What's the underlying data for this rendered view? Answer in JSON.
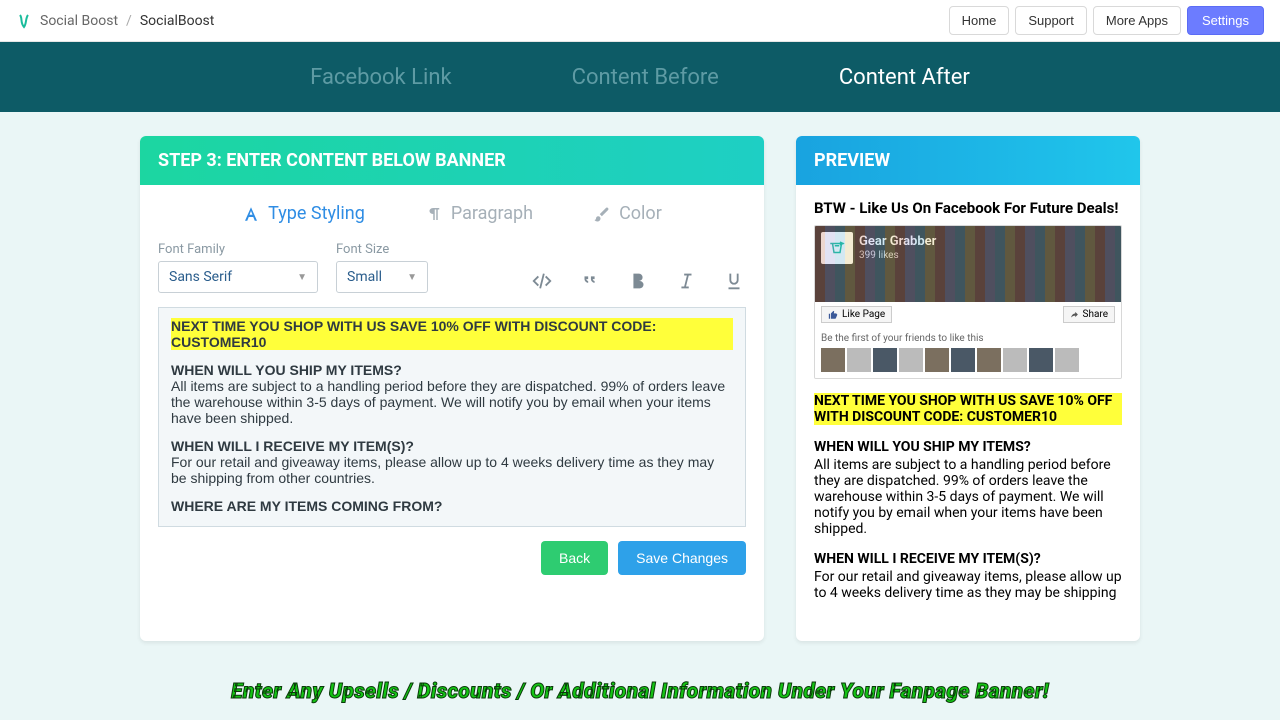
{
  "breadcrumb": {
    "app": "Social Boost",
    "page": "SocialBoost"
  },
  "topnav": {
    "home": "Home",
    "support": "Support",
    "more": "More Apps",
    "settings": "Settings"
  },
  "tabs": {
    "facebook": "Facebook Link",
    "before": "Content Before",
    "after": "Content After"
  },
  "editor": {
    "header": "STEP 3: ENTER CONTENT BELOW BANNER",
    "subtabs": {
      "type": "Type Styling",
      "paragraph": "Paragraph",
      "color": "Color"
    },
    "fields": {
      "font_family_label": "Font Family",
      "font_family_value": "Sans Serif",
      "font_size_label": "Font Size",
      "font_size_value": "Small"
    },
    "content": {
      "promo": "NEXT TIME YOU SHOP WITH US SAVE 10% OFF WITH DISCOUNT CODE: CUSTOMER10",
      "q1": "WHEN WILL YOU SHIP MY ITEMS?",
      "a1": "All items are subject to a handling period before they are dispatched. 99% of orders leave the warehouse within 3-5 days of payment. We will notify you by email when your items have been shipped.",
      "q2": "WHEN WILL I RECEIVE MY ITEM(S)?",
      "a2": "For our retail and giveaway items, please allow up to 4 weeks delivery time as they may be shipping from other countries.",
      "q3": "WHERE ARE MY ITEMS COMING FROM?"
    },
    "actions": {
      "back": "Back",
      "save": "Save Changes"
    }
  },
  "preview": {
    "header": "PREVIEW",
    "title": "BTW - Like Us On Facebook For Future Deals!",
    "fb": {
      "page_name": "Gear Grabber",
      "likes": "399 likes",
      "like_label": "Like Page",
      "share_label": "Share",
      "friends_text": "Be the first of your friends to like this"
    },
    "content": {
      "promo": "NEXT TIME YOU SHOP WITH US SAVE 10% OFF WITH DISCOUNT CODE: CUSTOMER10",
      "q1": "WHEN WILL YOU SHIP MY ITEMS?",
      "a1": "All items are subject to a handling period before they are dispatched. 99% of orders leave the warehouse within 3-5 days of payment. We will notify you by email when your items have been shipped.",
      "q2": "WHEN WILL I RECEIVE MY ITEM(S)?",
      "a2": "For our retail and giveaway items, please allow up to 4 weeks delivery time as they may be shipping"
    }
  },
  "caption": "Enter Any Upsells / Discounts / Or Additional Information Under Your Fanpage Banner!"
}
